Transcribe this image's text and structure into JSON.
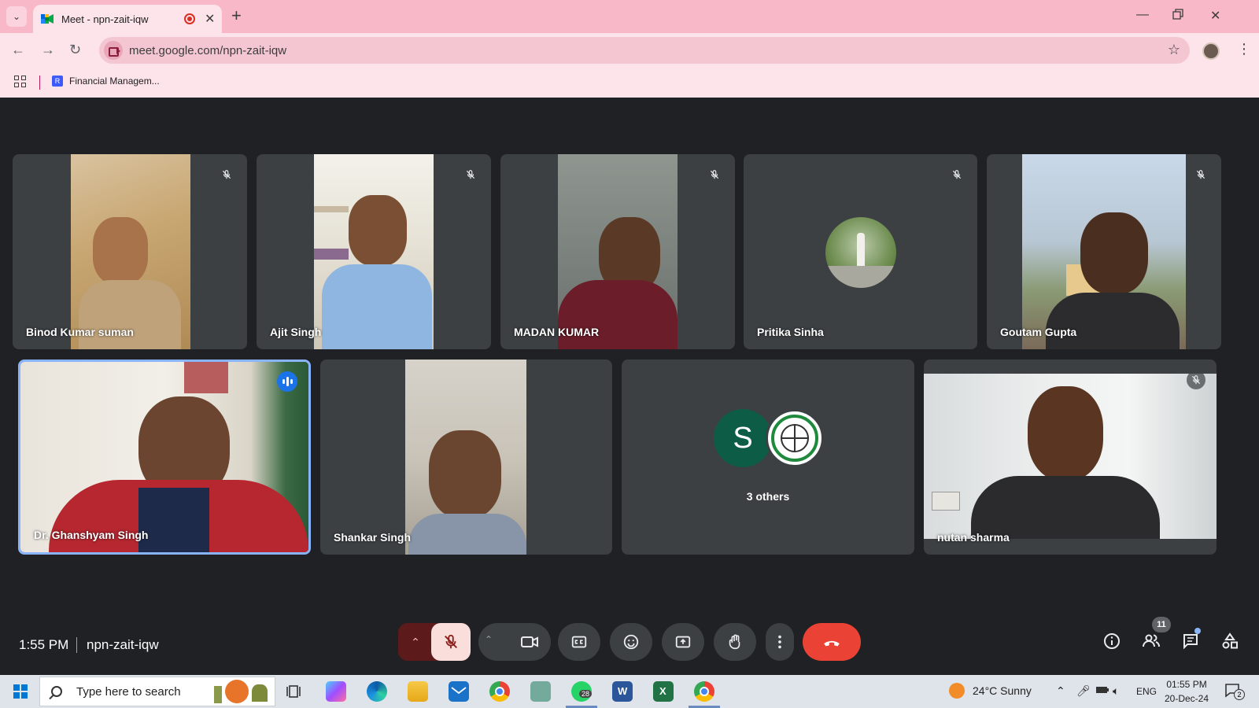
{
  "browser": {
    "tab_title": "Meet - npn-zait-iqw",
    "url": "meet.google.com/npn-zait-iqw",
    "bookmark_label": "Financial Managem..."
  },
  "meeting": {
    "time": "1:55 PM",
    "code": "npn-zait-iqw",
    "participant_count": "11"
  },
  "participants": [
    {
      "name": "Binod Kumar suman",
      "muted": true,
      "video": true
    },
    {
      "name": "Ajit Singh",
      "muted": true,
      "video": true
    },
    {
      "name": "MADAN KUMAR",
      "muted": true,
      "video": true
    },
    {
      "name": "Pritika Sinha",
      "muted": true,
      "video": false
    },
    {
      "name": "Goutam Gupta",
      "muted": true,
      "video": true
    },
    {
      "name": "Dr. Ghanshyam Singh",
      "muted": false,
      "speaking": true,
      "video": true
    },
    {
      "name": "Shankar Singh",
      "muted": false,
      "video": true
    },
    {
      "name": "3 others",
      "avatar_letter": "S"
    },
    {
      "name": "nutan sharma",
      "muted": true,
      "video": true
    }
  ],
  "taskbar": {
    "search_placeholder": "Type here to search",
    "weather": "24°C  Sunny",
    "language": "ENG",
    "time": "01:55 PM",
    "date": "20-Dec-24",
    "whatsapp_badge": "28",
    "notification_count": "2"
  },
  "colors": {
    "meet_bg": "#202124",
    "tile_bg": "#3c4043",
    "hangup": "#ea4335",
    "active_speaker": "#8ab4f8",
    "browser_frame": "#f9b8c8"
  }
}
